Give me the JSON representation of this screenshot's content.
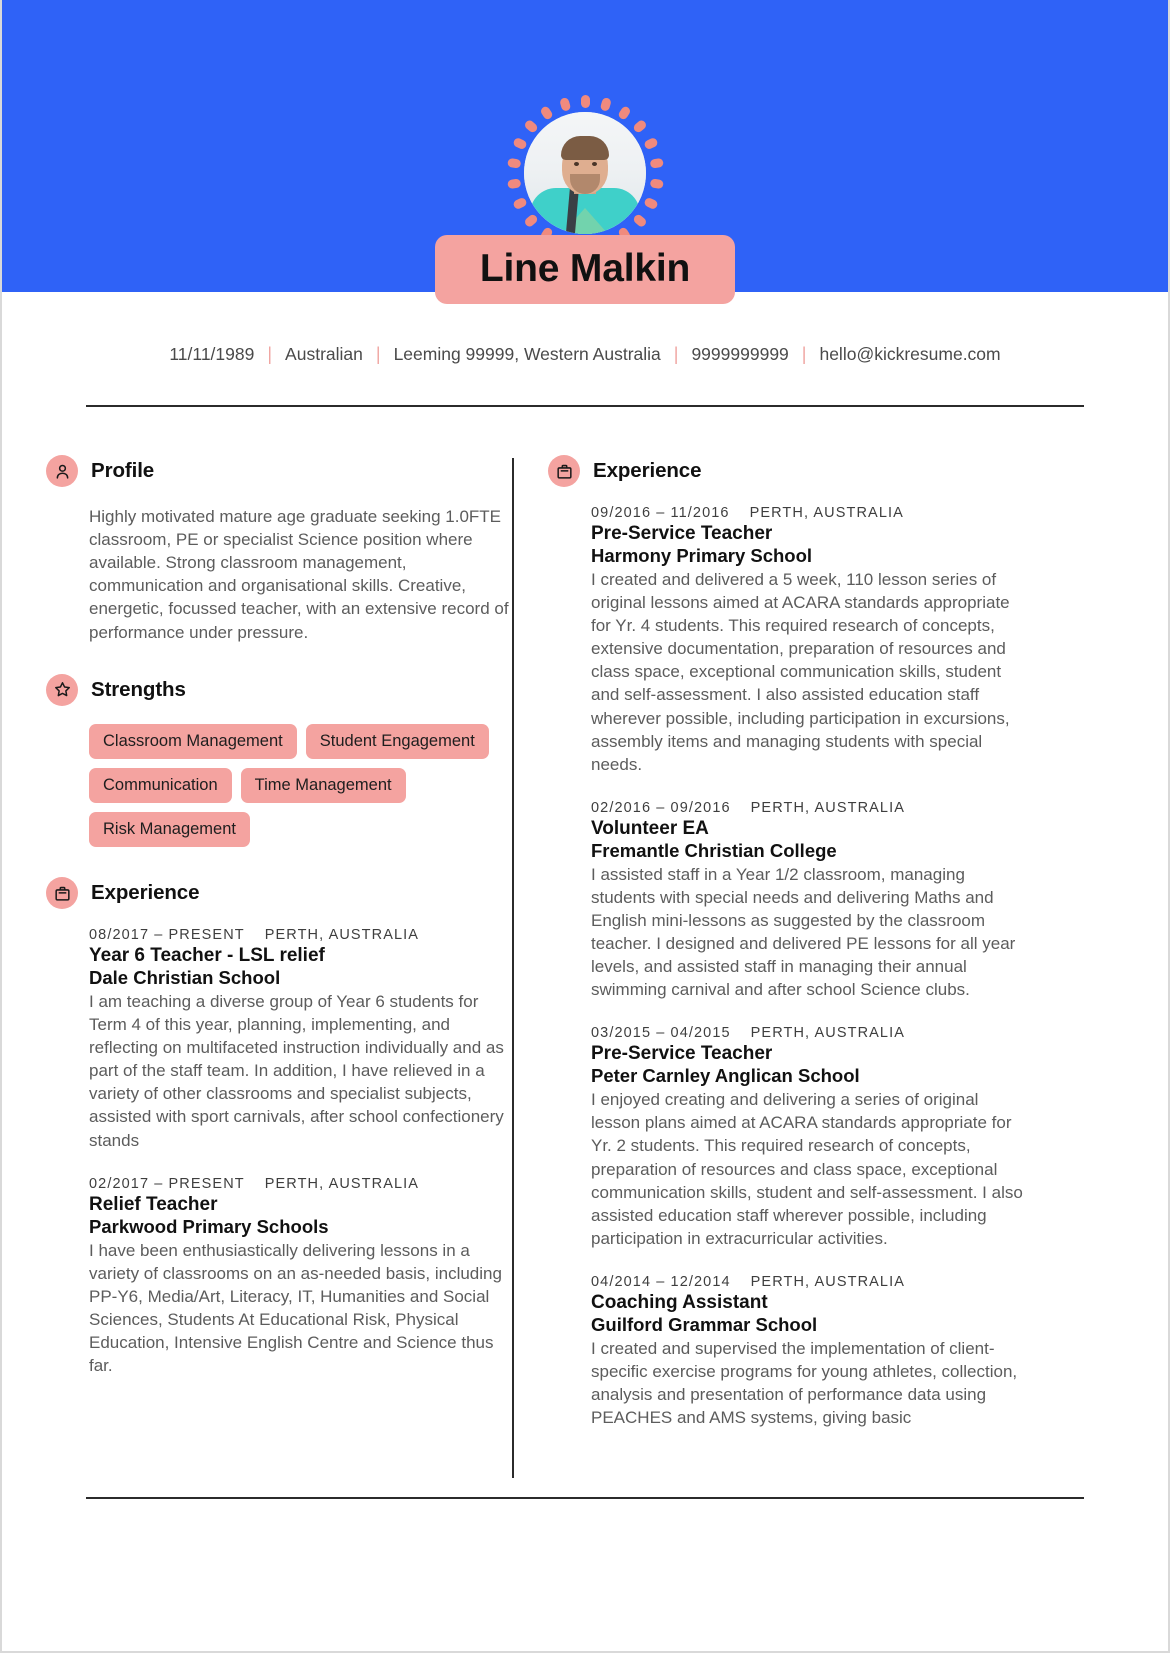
{
  "header": {
    "name": "Line Malkin",
    "band_color": "#2f62f7",
    "accent_color": "#f4a3a0",
    "avatar": "profile-photo"
  },
  "contact": {
    "items": [
      "11/11/1989",
      "Australian",
      "Leeming 99999, Western Australia",
      "9999999999",
      "hello@kickresume.com"
    ],
    "separator": "|"
  },
  "left_column": {
    "profile": {
      "icon": "person-icon",
      "title": "Profile",
      "text": "Highly motivated mature age graduate seeking 1.0FTE classroom, PE or specialist Science position where available. Strong classroom management, communication and organisational skills. Creative, energetic, focussed teacher, with an extensive record of performance under pressure."
    },
    "strengths": {
      "icon": "star-icon",
      "title": "Strengths",
      "tags": [
        "Classroom Management",
        "Student Engagement",
        "Communication",
        "Time Management",
        "Risk Management"
      ]
    },
    "experience": {
      "icon": "briefcase-icon",
      "title": "Experience",
      "items": [
        {
          "dates": "08/2017 – PRESENT",
          "location": "PERTH, AUSTRALIA",
          "role": "Year 6 Teacher - LSL relief",
          "org": "Dale Christian School",
          "desc": "I am teaching a diverse group of Year 6 students for Term 4 of this year, planning, implementing, and reflecting on multifaceted instruction individually and as part of the staff team. In addition, I have relieved in a variety of other classrooms and specialist subjects, assisted with sport carnivals, after school confectionery stands"
        },
        {
          "dates": "02/2017 – PRESENT",
          "location": "PERTH, AUSTRALIA",
          "role": "Relief Teacher",
          "org": "Parkwood Primary Schools",
          "desc": "I have been enthusiastically delivering lessons in a variety of classrooms on an as-needed basis, including PP-Y6, Media/Art, Literacy, IT, Humanities and Social Sciences, Students At Educational Risk, Physical Education, Intensive English Centre and Science thus far."
        }
      ]
    }
  },
  "right_column": {
    "experience": {
      "icon": "briefcase-icon",
      "title": "Experience",
      "items": [
        {
          "dates": "09/2016 – 11/2016",
          "location": "PERTH, AUSTRALIA",
          "role": "Pre-Service Teacher",
          "org": "Harmony Primary School",
          "desc": "I created and delivered a 5 week, 110 lesson series of original lessons aimed at ACARA standards appropriate for Yr. 4 students. This required research of concepts, extensive documentation, preparation of resources and class space, exceptional communication skills, student and self-assessment. I also assisted education staff wherever possible, including participation in excursions, assembly items and managing students with special needs."
        },
        {
          "dates": "02/2016 – 09/2016",
          "location": "PERTH, AUSTRALIA",
          "role": "Volunteer EA",
          "org": "Fremantle Christian College",
          "desc": "I assisted staff in a Year 1/2 classroom, managing students with special needs and delivering Maths and English mini-lessons as suggested by the classroom teacher. I designed and delivered PE lessons for all year levels, and assisted staff in managing their annual swimming carnival and after school Science clubs."
        },
        {
          "dates": "03/2015 – 04/2015",
          "location": "PERTH, AUSTRALIA",
          "role": "Pre-Service Teacher",
          "org": "Peter Carnley Anglican School",
          "desc": "I enjoyed creating and delivering a series of original lesson plans aimed at ACARA standards appropriate for Yr. 2 students. This required research of concepts, preparation of resources and class space, exceptional communication skills, student and self-assessment. I also assisted education staff wherever possible, including participation in extracurricular activities."
        },
        {
          "dates": "04/2014 – 12/2014",
          "location": "PERTH, AUSTRALIA",
          "role": "Coaching Assistant",
          "org": "Guilford Grammar School",
          "desc": "I created and supervised the implementation of client-specific exercise programs for young athletes, collection, analysis and presentation of performance data using PEACHES and AMS systems, giving basic"
        }
      ]
    }
  }
}
